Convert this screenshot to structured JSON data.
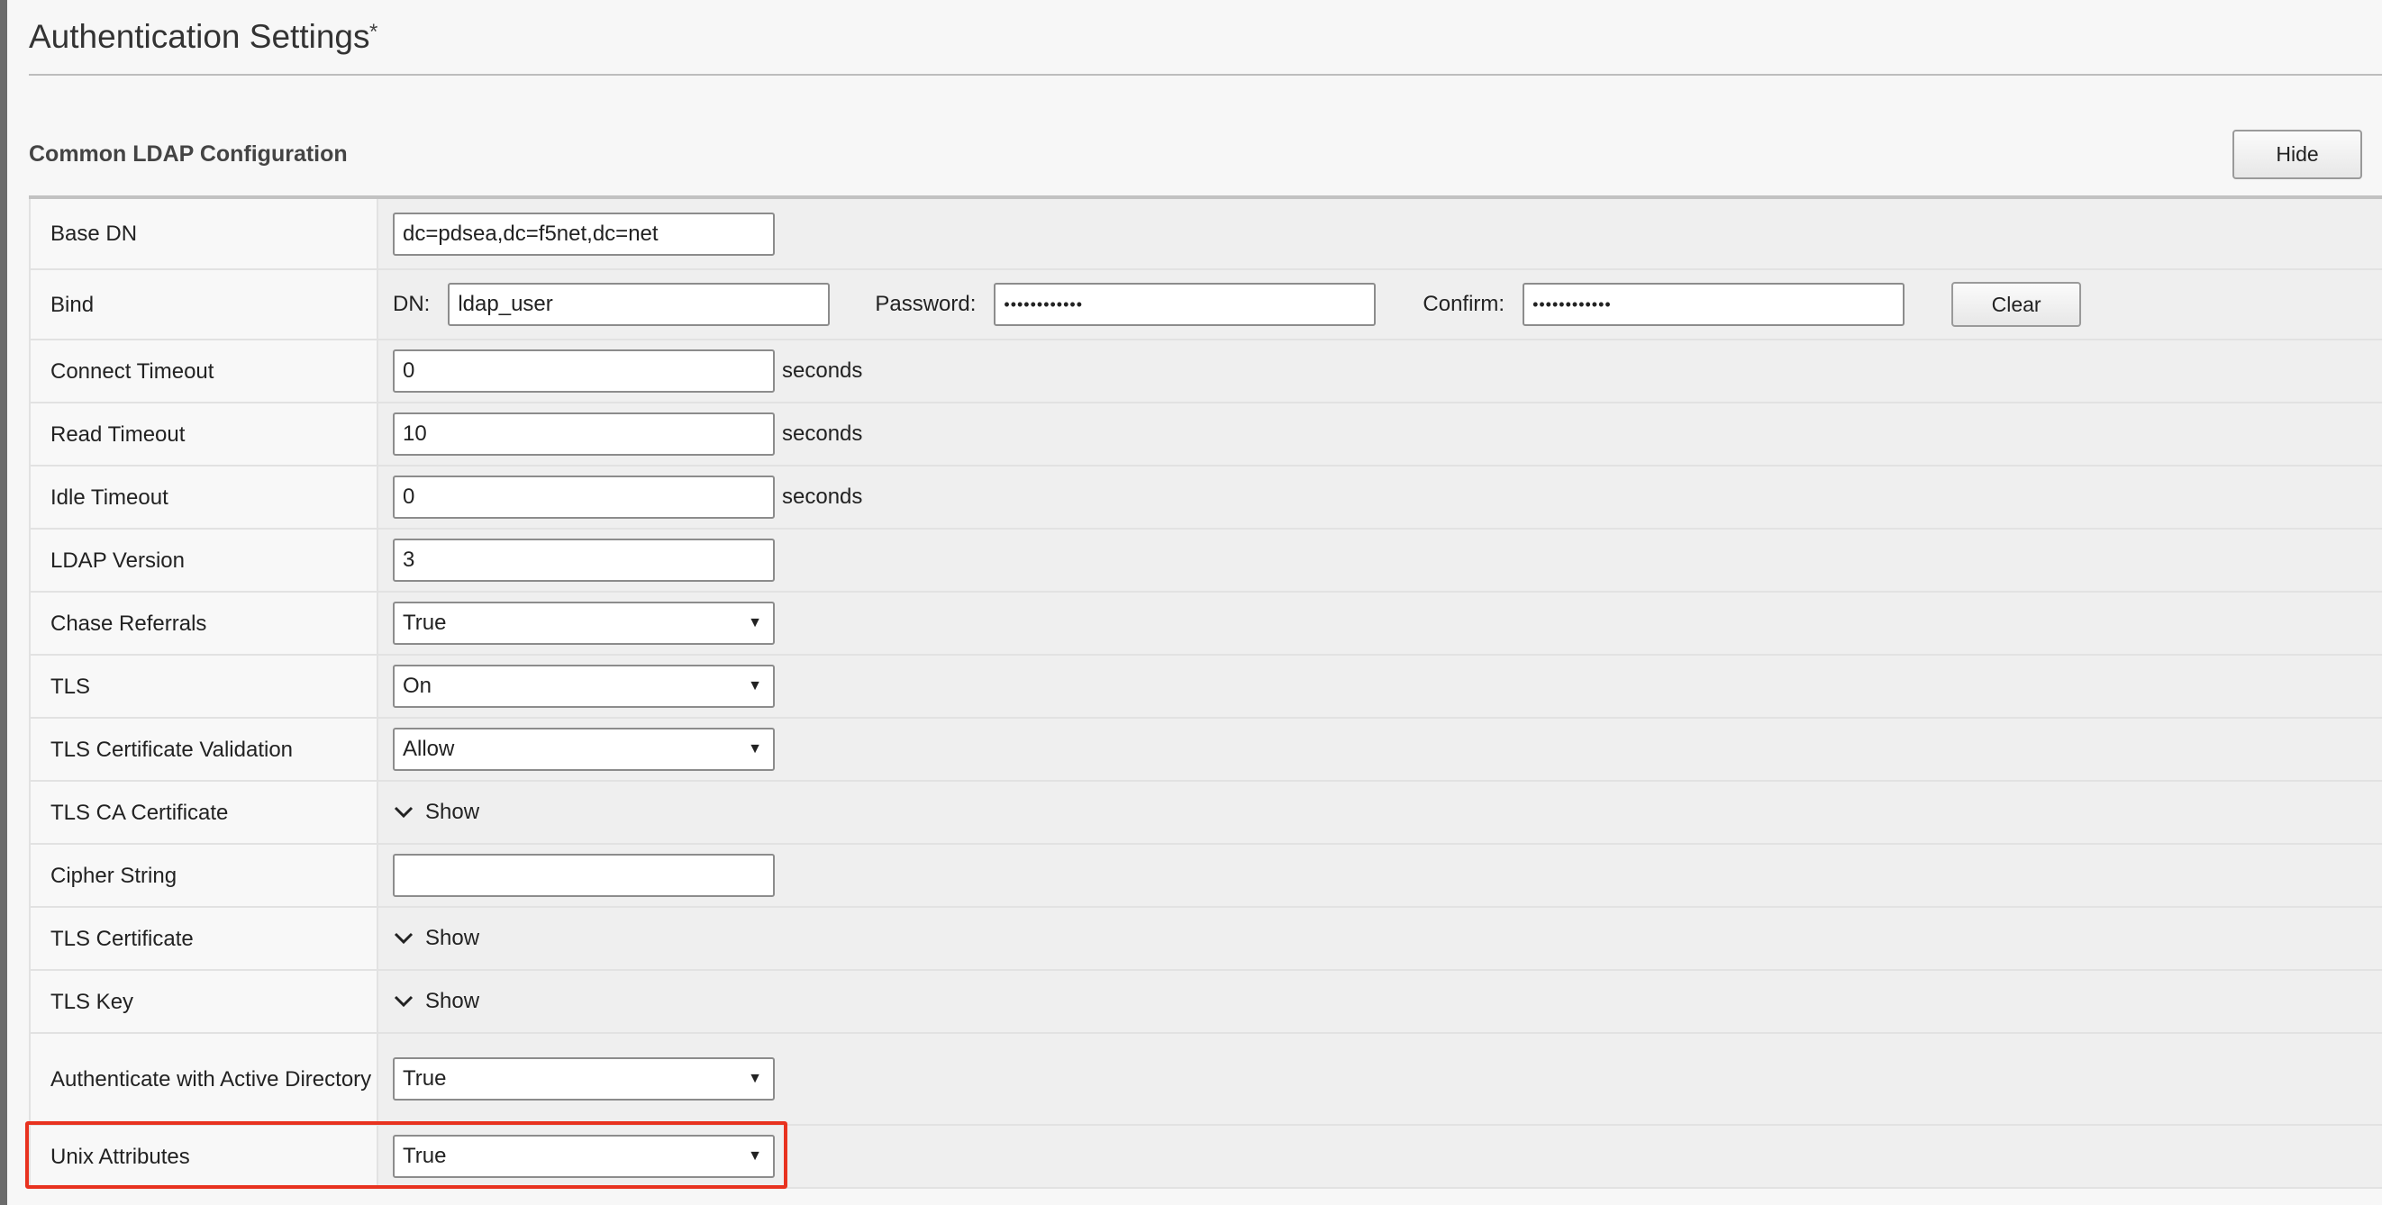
{
  "header": {
    "title": "Authentication Settings",
    "asterisk": "*"
  },
  "section": {
    "title": "Common LDAP Configuration",
    "hide_label": "Hide"
  },
  "fields": {
    "base_dn": {
      "label": "Base DN",
      "value": "dc=pdsea,dc=f5net,dc=net"
    },
    "bind": {
      "label": "Bind",
      "dn_label": "DN:",
      "dn_value": "ldap_user",
      "password_label": "Password:",
      "password_value": "••••••••••••",
      "confirm_label": "Confirm:",
      "confirm_value": "••••••••••••",
      "clear_label": "Clear"
    },
    "connect_timeout": {
      "label": "Connect Timeout",
      "value": "0",
      "unit": "seconds"
    },
    "read_timeout": {
      "label": "Read Timeout",
      "value": "10",
      "unit": "seconds"
    },
    "idle_timeout": {
      "label": "Idle Timeout",
      "value": "0",
      "unit": "seconds"
    },
    "ldap_version": {
      "label": "LDAP Version",
      "value": "3"
    },
    "chase_referrals": {
      "label": "Chase Referrals",
      "value": "True"
    },
    "tls": {
      "label": "TLS",
      "value": "On"
    },
    "tls_cert_validation": {
      "label": "TLS Certificate Validation",
      "value": "Allow"
    },
    "tls_ca_certificate": {
      "label": "TLS CA Certificate",
      "toggle": "Show"
    },
    "cipher_string": {
      "label": "Cipher String",
      "value": ""
    },
    "tls_certificate": {
      "label": "TLS Certificate",
      "toggle": "Show"
    },
    "tls_key": {
      "label": "TLS Key",
      "toggle": "Show"
    },
    "auth_active_directory": {
      "label": "Authenticate with Active Directory",
      "value": "True"
    },
    "unix_attributes": {
      "label": "Unix Attributes",
      "value": "True"
    }
  },
  "icons": {
    "dropdown": "triangle-down-icon",
    "toggle": "chevron-down-icon"
  },
  "colors": {
    "highlight": "#e8321f",
    "label_bg": "#f8f8f8",
    "value_bg": "#efefef"
  }
}
